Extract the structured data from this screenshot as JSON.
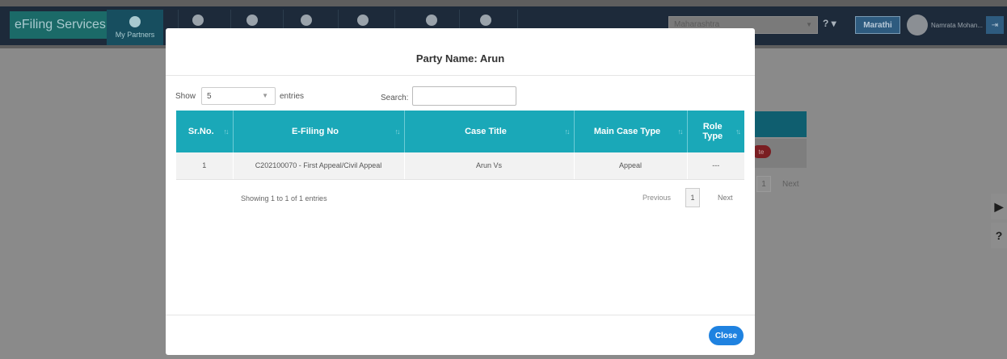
{
  "navbar": {
    "brand": "eFiling Services",
    "partners_label": "My Partners",
    "state_value": "Maharashtra",
    "help_label": "? ▾",
    "language_button": "Marathi",
    "user_name": "Namrata Mohan..."
  },
  "background": {
    "pill_text": "te",
    "page_number": "1",
    "next_label": "Next"
  },
  "modal": {
    "title": "Party Name: Arun",
    "show_label": "Show",
    "page_length_value": "5",
    "entries_label": "entries",
    "search_label": "Search:",
    "search_value": "",
    "columns": [
      "Sr.No.",
      "E-Filing No",
      "Case Title",
      "Main Case Type",
      "Role Type"
    ],
    "rows": [
      {
        "sr_no": "1",
        "efiling_no": "C202100070 - First Appeal/Civil Appeal",
        "case_title": "Arun Vs",
        "main_case_type": "Appeal",
        "role_type": "---"
      }
    ],
    "info_text": "Showing 1 to 1 of 1 entries",
    "previous_label": "Previous",
    "current_page": "1",
    "next_label": "Next",
    "close_button": "Close"
  },
  "colors": {
    "table_header": "#1aa8b8",
    "close_button": "#1f82e0",
    "overlay": "#8a8a8a"
  }
}
